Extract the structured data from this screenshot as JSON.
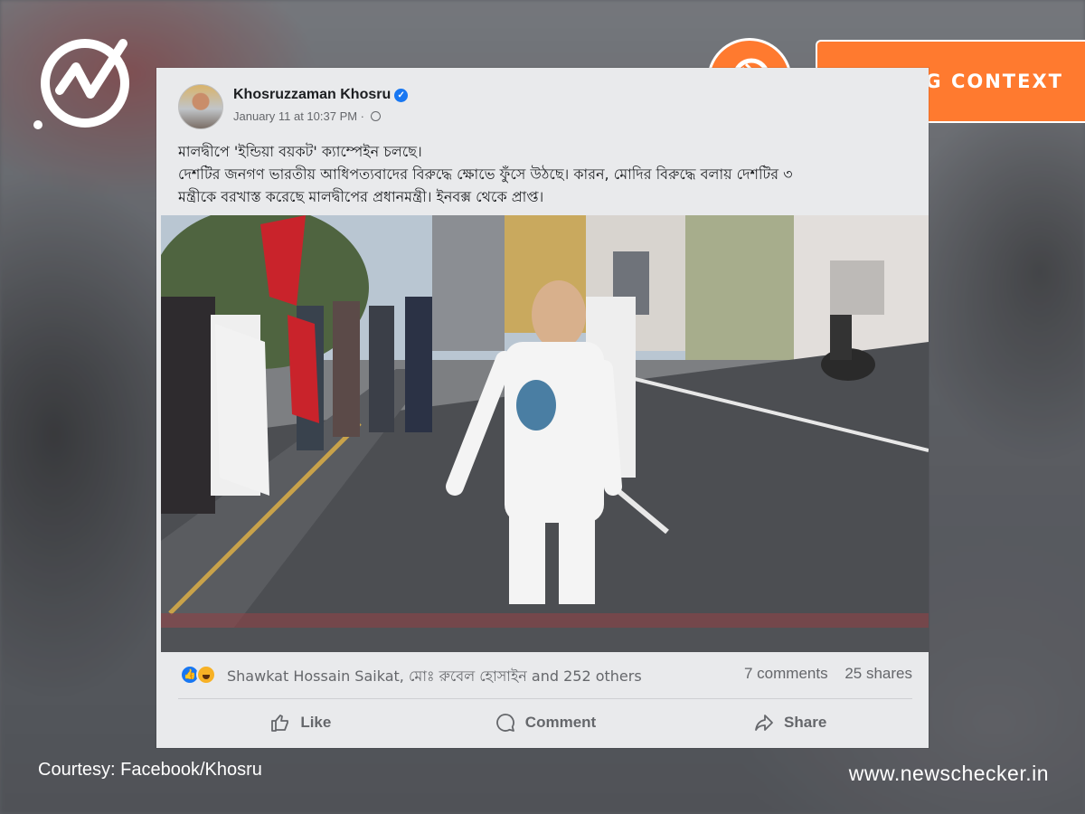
{
  "post": {
    "author": "Khosruzzaman Khosru",
    "timestamp": "January 11 at 10:37 PM ·",
    "text_lines": [
      "মালদ্বীপে 'ইন্ডিয়া বয়কট' ক্যাম্পেইন চলছে।",
      "দেশটির জনগণ ভারতীয় আধিপত্যবাদের বিরুদ্ধে ক্ষোভে ফুঁসে উঠছে। কারন, মোদির বিরুদ্ধে বলায় দেশটির ৩",
      "মন্ত্রীকে বরখাস্ত করেছে মালদ্বীপের প্রধানমন্ত্রী। ইনবক্স থেকে প্রাপ্ত।"
    ]
  },
  "reactions": {
    "names": "Shawkat Hossain Saikat, মোঃ রুবেল হোসাইন and 252 others",
    "comments": "7 comments",
    "shares": "25 shares"
  },
  "actions": {
    "like": "Like",
    "comment": "Comment",
    "share": "Share"
  },
  "badge": {
    "label": "MISSING CONTEXT",
    "color": "#ff7a2f"
  },
  "footer": {
    "courtesy": "Courtesy: Facebook/Khosru",
    "site": "www.newschecker.in"
  },
  "icons": [
    "newschecker-logo-icon",
    "magnifier-icon",
    "verified-icon",
    "globe-icon",
    "like-icon",
    "comment-icon",
    "share-icon"
  ]
}
